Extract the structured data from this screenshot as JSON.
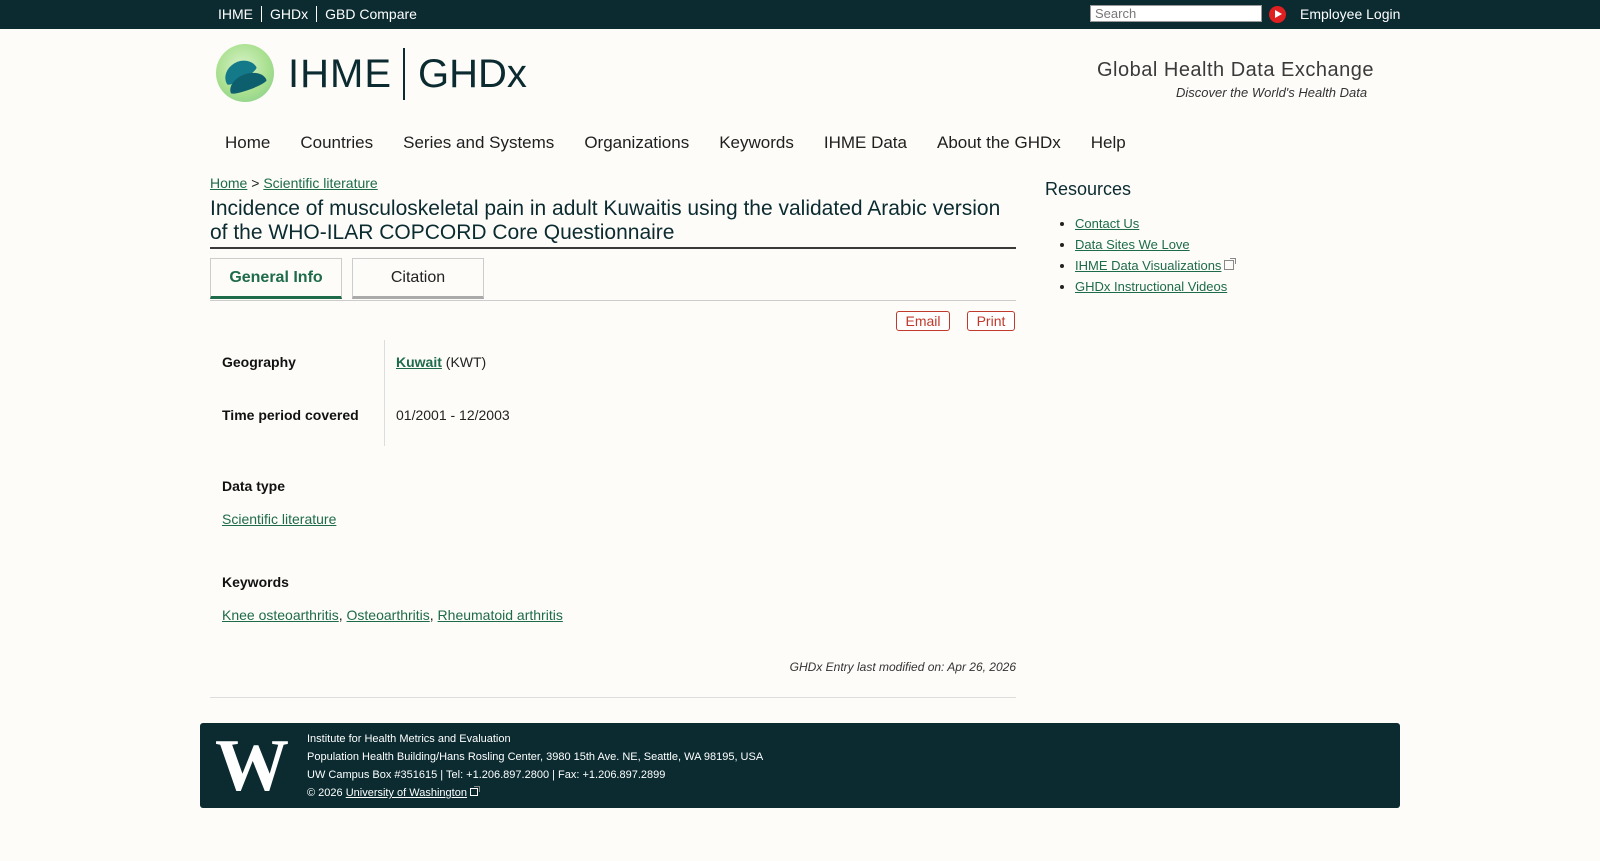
{
  "topbar": {
    "links": [
      "IHME",
      "GHDx",
      "GBD Compare"
    ],
    "search_placeholder": "Search",
    "login": "Employee Login"
  },
  "header": {
    "logo_ihme": "IHME",
    "logo_ghdx": "GHDx",
    "tagline_title": "Global Health Data Exchange",
    "tagline_sub": "Discover the World's Health Data"
  },
  "nav": [
    "Home",
    "Countries",
    "Series and Systems",
    "Organizations",
    "Keywords",
    "IHME Data",
    "About the GHDx",
    "Help"
  ],
  "breadcrumb": {
    "home": "Home",
    "sep": ">",
    "current": "Scientific literature"
  },
  "page_title": "Incidence of musculoskeletal pain in adult Kuwaitis using the validated Arabic version of the WHO-ILAR COPCORD Core Questionnaire",
  "tabs": {
    "general": "General Info",
    "citation": "Citation"
  },
  "actions": {
    "email": "Email",
    "print": "Print"
  },
  "details": {
    "geography_label": "Geography",
    "geography_value": "Kuwait",
    "geography_code": "(KWT)",
    "time_label": "Time period covered",
    "time_value": "01/2001 - 12/2003",
    "datatype_label": "Data type",
    "datatype_value": "Scientific literature",
    "keywords_label": "Keywords",
    "keywords": [
      "Knee osteoarthritis",
      "Osteoarthritis",
      "Rheumatoid arthritis"
    ]
  },
  "modified": "GHDx Entry last modified on: Apr 26, 2026",
  "sidebar": {
    "title": "Resources",
    "items": [
      "Contact Us",
      "Data Sites We Love",
      "IHME Data Visualizations",
      "GHDx Instructional Videos"
    ]
  },
  "footer": {
    "logo": "W",
    "line1": "Institute for Health Metrics and Evaluation",
    "line2": "Population Health Building/Hans Rosling Center, 3980 15th Ave. NE, Seattle, WA 98195, USA",
    "line3": "UW Campus Box #351615 | Tel: +1.206.897.2800 | Fax: +1.206.897.2899",
    "copyright": "© 2026",
    "uw_link": "University of Washington"
  }
}
